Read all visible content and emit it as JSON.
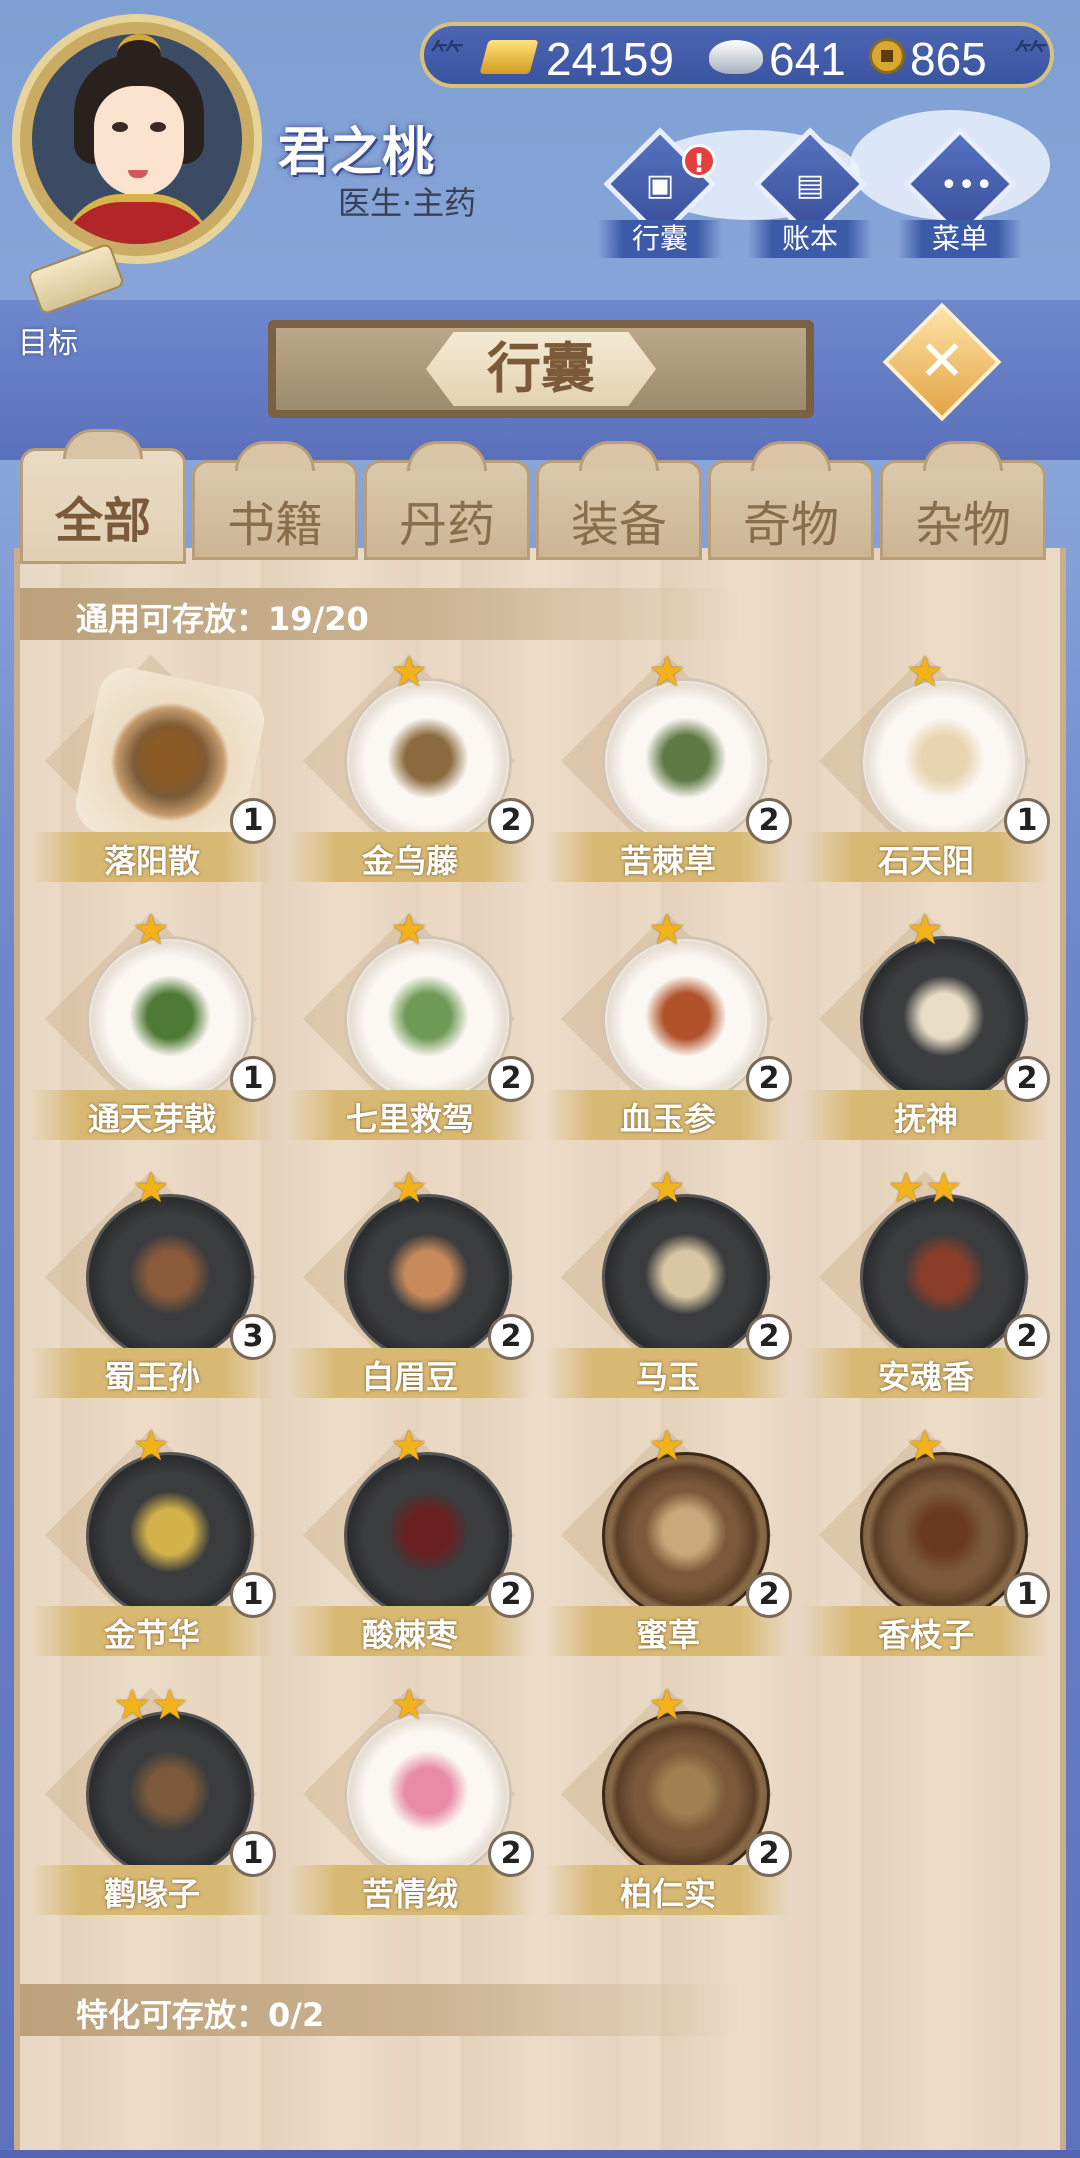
{
  "header": {
    "player_name": "君之桃",
    "player_role": "医生·主药",
    "currency": {
      "gold": "24159",
      "silver": "641",
      "coins": "865"
    }
  },
  "menu": [
    {
      "label": "行囊",
      "icon": "bag-icon",
      "has_alert": true,
      "alert": "!"
    },
    {
      "label": "账本",
      "icon": "ledger-icon",
      "has_alert": false
    },
    {
      "label": "菜单",
      "icon": "more-icon",
      "has_alert": false
    }
  ],
  "goal_label": "目标",
  "panel": {
    "title": "行囊",
    "close_label": "✕",
    "tabs": [
      "全部",
      "书籍",
      "丹药",
      "装备",
      "奇物",
      "杂物"
    ],
    "active_tab": "全部",
    "general_storage": "通用可存放：19/20",
    "special_storage": "特化可存放：0/2"
  },
  "items": [
    {
      "name": "落阳散",
      "count": "1",
      "stars": 0,
      "plate": "paper",
      "herb": "#8b5a25"
    },
    {
      "name": "金乌藤",
      "count": "2",
      "stars": 1,
      "plate": "white",
      "herb": "#8a6a3e"
    },
    {
      "name": "苦棘草",
      "count": "2",
      "stars": 1,
      "plate": "white",
      "herb": "#5f7a45"
    },
    {
      "name": "石天阳",
      "count": "1",
      "stars": 1,
      "plate": "white",
      "herb": "#e8d4b0"
    },
    {
      "name": "通天芽戟",
      "count": "1",
      "stars": 1,
      "plate": "white",
      "herb": "#4f7a35"
    },
    {
      "name": "七里救驾",
      "count": "2",
      "stars": 1,
      "plate": "white",
      "herb": "#6f9a55"
    },
    {
      "name": "血玉参",
      "count": "2",
      "stars": 1,
      "plate": "white",
      "herb": "#b0522a"
    },
    {
      "name": "抚神",
      "count": "2",
      "stars": 1,
      "plate": "black",
      "herb": "#e9dcc4"
    },
    {
      "name": "蜀王孙",
      "count": "3",
      "stars": 1,
      "plate": "black",
      "herb": "#8a5a3a"
    },
    {
      "name": "白眉豆",
      "count": "2",
      "stars": 1,
      "plate": "black",
      "herb": "#c98a5a"
    },
    {
      "name": "马玉",
      "count": "2",
      "stars": 1,
      "plate": "black",
      "herb": "#d9c7a4"
    },
    {
      "name": "安魂香",
      "count": "2",
      "stars": 2,
      "plate": "black",
      "herb": "#8a3e2a"
    },
    {
      "name": "金节华",
      "count": "1",
      "stars": 1,
      "plate": "black",
      "herb": "#d4b24a"
    },
    {
      "name": "酸棘枣",
      "count": "2",
      "stars": 1,
      "plate": "black",
      "herb": "#6a2020"
    },
    {
      "name": "蜜草",
      "count": "2",
      "stars": 1,
      "plate": "bowl",
      "herb": "#c9a97a"
    },
    {
      "name": "香枝子",
      "count": "1",
      "stars": 1,
      "plate": "bowl",
      "herb": "#6a3a20"
    },
    {
      "name": "鹳喙子",
      "count": "1",
      "stars": 2,
      "plate": "black",
      "herb": "#7a5a3a"
    },
    {
      "name": "苦情绒",
      "count": "2",
      "stars": 1,
      "plate": "white",
      "herb": "#e88aa8"
    },
    {
      "name": "柏仁实",
      "count": "2",
      "stars": 1,
      "plate": "bowl",
      "herb": "#a08050"
    }
  ]
}
